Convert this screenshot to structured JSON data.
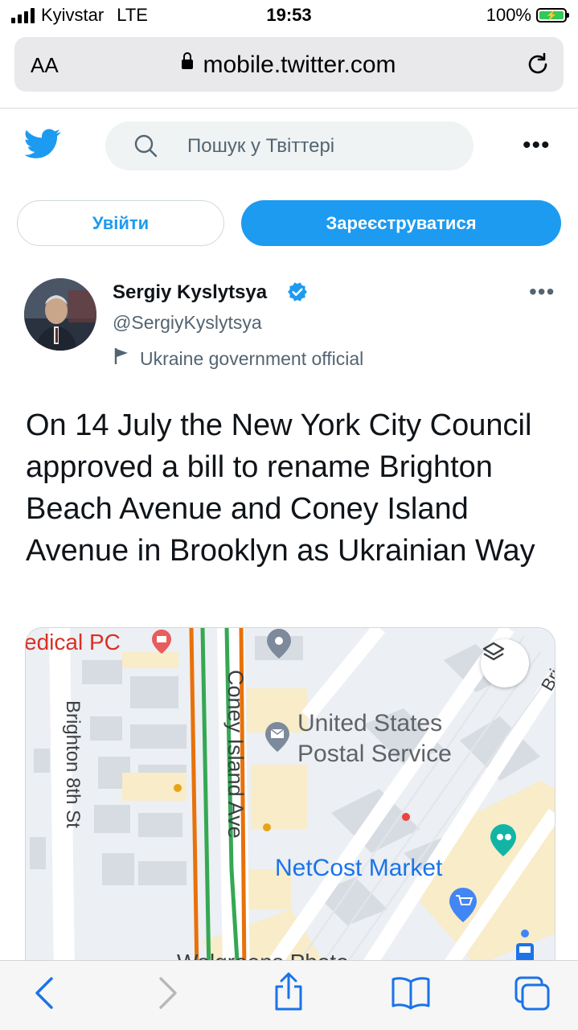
{
  "status_bar": {
    "carrier": "Kyivstar",
    "network": "LTE",
    "time": "19:53",
    "battery": "100%"
  },
  "browser": {
    "text_size_label": "AA",
    "url": "mobile.twitter.com"
  },
  "header": {
    "search_placeholder": "Пошук у Твіттері"
  },
  "auth": {
    "login_label": "Увійти",
    "signup_label": "Зареєструватися"
  },
  "tweet": {
    "author_name": "Sergiy Kyslytsya",
    "author_handle": "@SergiyKyslytsya",
    "author_label": "Ukraine government official",
    "text": "On 14 July the New York City Council approved a bill to rename Brighton Beach Avenue and Coney Island Avenue in Brooklyn as Ukrainian Way"
  },
  "map": {
    "labels": {
      "medical": "edical PC",
      "brighton_8th": "Brighton 8th St",
      "coney_island": "Coney Island Ave",
      "usps": [
        "United States",
        "Postal Service"
      ],
      "netcost": "NetCost Market",
      "walgreens": "Walgreens Photo",
      "bri": "Bri"
    }
  },
  "colors": {
    "twitter_blue": "#1d9bf0",
    "text_primary": "#0f1419",
    "text_secondary": "#536471",
    "map_blue": "#1a73e8"
  }
}
